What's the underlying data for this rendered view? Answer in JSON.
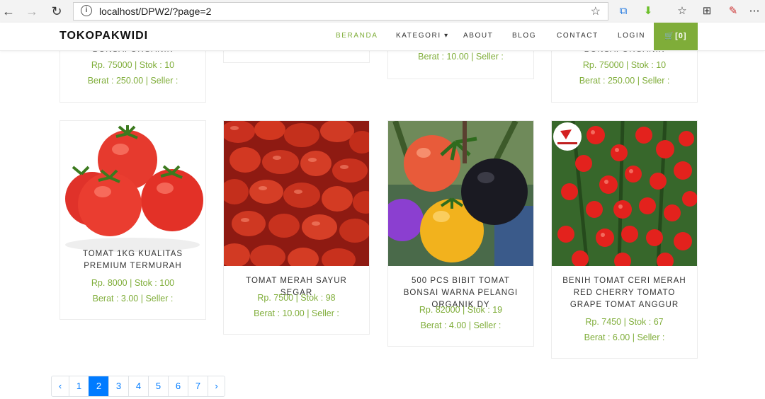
{
  "browser": {
    "url": "localhost/DPW2/?page=2"
  },
  "site": {
    "brand": "TOKOPAKWIDI",
    "menu": [
      "BERANDA",
      "KATEGORI ▾",
      "ABOUT",
      "BLOG",
      "CONTACT",
      "LOGIN"
    ],
    "cart_label": "🛒[0]",
    "accent_color": "#7fad39"
  },
  "top_row": [
    {
      "name_partial": "BONSAI ORGANIK",
      "price": "Rp. 75000 | Stok : 10",
      "weight": "Berat : 250.00 | Seller :"
    },
    {
      "name_partial": "",
      "price": "",
      "weight": ""
    },
    {
      "name_partial": "",
      "price": "",
      "weight": "Berat : 10.00 | Seller :"
    },
    {
      "name_partial": "BONSAI ORGANIK",
      "price": "Rp. 75000 | Stok : 10",
      "weight": "Berat : 250.00 | Seller :"
    }
  ],
  "products": [
    {
      "name": "TOMAT 1KG KUALITAS PREMIUM TERMURAH",
      "price": "Rp. 8000 | Stok : 100",
      "weight": "Berat : 3.00 | Seller :"
    },
    {
      "name": "TOMAT MERAH SAYUR SEGAR",
      "price": "Rp. 7500 | Stok : 98",
      "weight": "Berat : 10.00 | Seller :"
    },
    {
      "name": "500 PCS BIBIT TOMAT BONSAI WARNA PELANGI ORGANIK DY",
      "price": "Rp. 82000 | Stok : 19",
      "weight": "Berat : 4.00 | Seller :"
    },
    {
      "name": "BENIH TOMAT CERI MERAH RED CHERRY TOMATO GRAPE TOMAT ANGGUR",
      "price": "Rp. 7450 | Stok : 67",
      "weight": "Berat : 6.00 | Seller :"
    }
  ],
  "pagination": [
    "‹",
    "1",
    "2",
    "3",
    "4",
    "5",
    "6",
    "7",
    "›"
  ],
  "pagination_active": "2"
}
